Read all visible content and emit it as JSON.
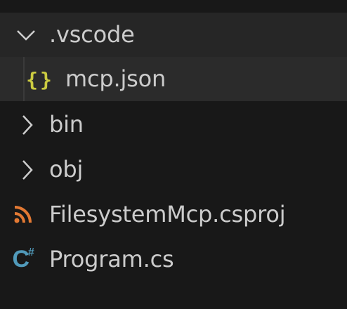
{
  "explorer": {
    "items": [
      {
        "label": "..",
        "type": "folder-partial"
      },
      {
        "label": ".vscode",
        "type": "folder",
        "expanded": true
      },
      {
        "label": "mcp.json",
        "type": "file",
        "icon": "json-icon",
        "selected": true
      },
      {
        "label": "bin",
        "type": "folder",
        "expanded": false
      },
      {
        "label": "obj",
        "type": "folder",
        "expanded": false
      },
      {
        "label": "FilesystemMcp.csproj",
        "type": "file",
        "icon": "rss-icon"
      },
      {
        "label": "Program.cs",
        "type": "file",
        "icon": "csharp-icon"
      }
    ]
  },
  "colors": {
    "background": "#181818",
    "hover_row": "#262626",
    "selected_row": "#2b2b2b",
    "text": "#cccccc",
    "json_icon": "#cbcb41",
    "rss_icon": "#e37933",
    "csharp_icon": "#519aba"
  }
}
